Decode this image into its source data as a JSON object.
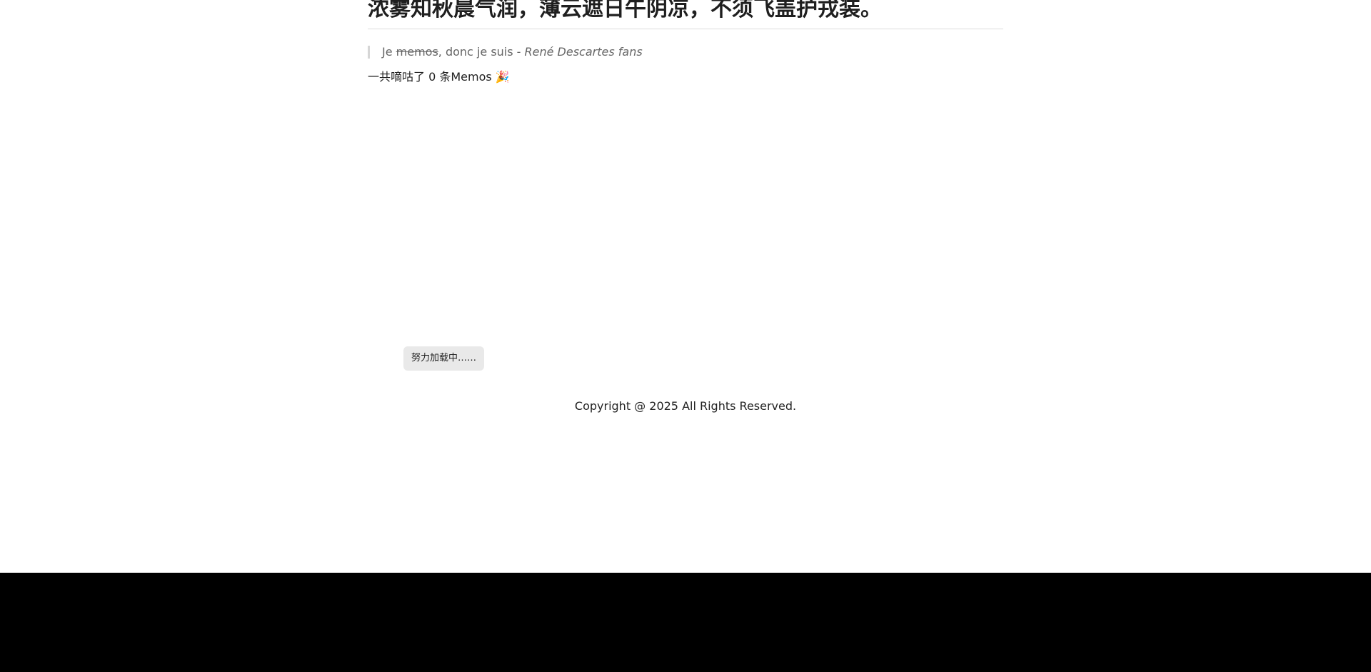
{
  "post": {
    "title": "浓雾知秋晨气润，薄云遮日午阴凉，不须飞盖护戎装。"
  },
  "quote": {
    "prefix": "Je ",
    "struck_word": "memos",
    "middle": ", donc je suis - ",
    "author": "René Descartes fans"
  },
  "stats": {
    "text": "一共嘀咕了 0 条Memos 🎉"
  },
  "loader": {
    "label": "努力加载中……"
  },
  "footer": {
    "copyright": "Copyright @ 2025 All Rights Reserved."
  }
}
